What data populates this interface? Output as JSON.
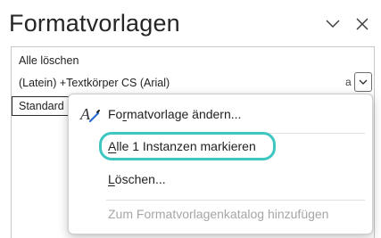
{
  "pane": {
    "title": "Formatvorlagen",
    "collapse_icon": "chevron-down-icon",
    "close_icon": "close-icon"
  },
  "list": {
    "clear_all": "Alle löschen",
    "font_row": "(Latein) +Textkörper CS (Arial)",
    "para_mark": "a",
    "style_name": "Standard"
  },
  "context_menu": {
    "items": [
      {
        "pre": "Fo",
        "ul": "r",
        "post": "matvorlage ändern...",
        "icon": "styles-pen-icon",
        "disabled": false
      },
      {
        "pre": "",
        "ul": "A",
        "post": "lle 1 Instanzen markieren",
        "icon": "",
        "disabled": false
      },
      {
        "pre": "",
        "ul": "L",
        "post": "öschen...",
        "icon": "",
        "disabled": false
      },
      {
        "pre": "",
        "ul": "",
        "post": "Zum Formatvorlagenkatalog hinzufügen",
        "icon": "",
        "disabled": true
      }
    ]
  },
  "colors": {
    "highlight_ring": "#3ec6c1",
    "icon_blue": "#2b6cd4"
  }
}
